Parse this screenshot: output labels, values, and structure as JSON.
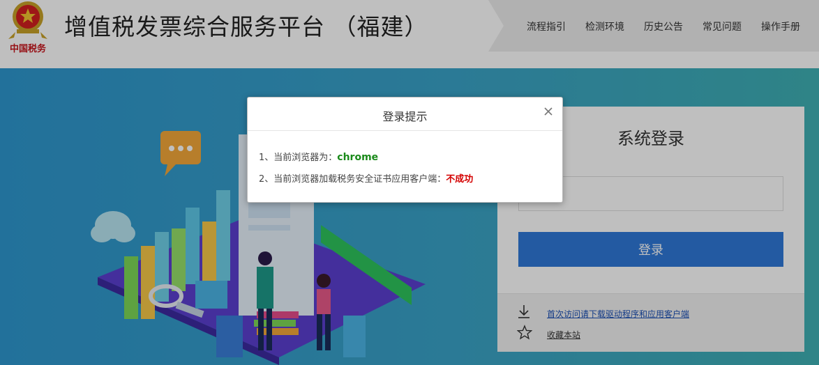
{
  "header": {
    "logo_text": "中国税务",
    "title": "增值税发票综合服务平台 （福建）",
    "nav": [
      "流程指引",
      "检测环境",
      "历史公告",
      "常见问题",
      "操作手册"
    ]
  },
  "login": {
    "title": "系统登录",
    "password_value": "••••••",
    "button_label": "登录",
    "download_link": "首次访问请下载驱动程序和应用客户端",
    "favorite_link": "收藏本站",
    "accent_color": "#2f79d8"
  },
  "dialog": {
    "title": "登录提示",
    "line1_label": "1、当前浏览器为：",
    "line1_value": "chrome",
    "line2_label": "2、当前浏览器加载税务安全证书应用客户端：",
    "line2_value": "不成功",
    "ok_color": "#1a8a1a",
    "fail_color": "#d40000"
  },
  "icons": [
    "emblem-icon",
    "download-icon",
    "star-icon",
    "close-icon",
    "chat-bubble-icon",
    "cloud-icon",
    "magnifier-icon"
  ]
}
